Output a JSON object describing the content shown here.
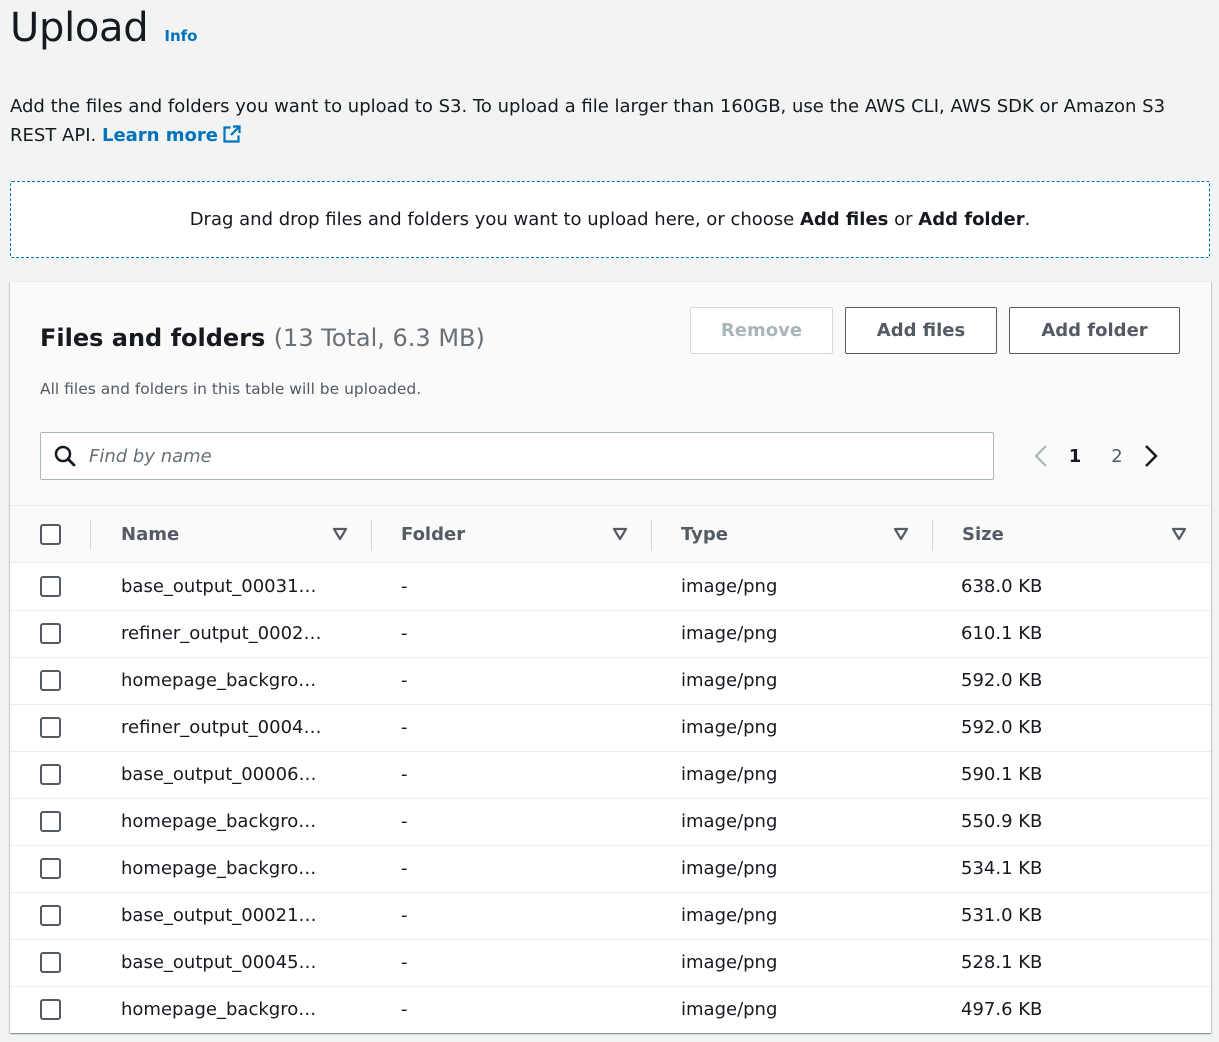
{
  "header": {
    "title": "Upload",
    "info_link": "Info"
  },
  "description": {
    "text": "Add the files and folders you want to upload to S3. To upload a file larger than 160GB, use the AWS CLI, AWS SDK or Amazon S3 REST API.",
    "learn_more": "Learn more"
  },
  "dropzone": {
    "text_before": "Drag and drop files and folders you want to upload here, or choose",
    "add_files": "Add files",
    "or": "or",
    "add_folder": "Add folder",
    "period": "."
  },
  "panel": {
    "title": "Files and folders",
    "count": "(13 Total, 6.3 MB)",
    "description": "All files and folders in this table will be uploaded.",
    "buttons": {
      "remove": "Remove",
      "add_files": "Add files",
      "add_folder": "Add folder"
    },
    "search": {
      "placeholder": "Find by name",
      "value": ""
    },
    "pagination": {
      "pages": [
        "1",
        "2"
      ],
      "current": "1"
    }
  },
  "table": {
    "columns": [
      "Name",
      "Folder",
      "Type",
      "Size"
    ],
    "rows": [
      {
        "name": "base_output_00031…",
        "folder": "-",
        "type": "image/png",
        "size": "638.0 KB"
      },
      {
        "name": "refiner_output_0002…",
        "folder": "-",
        "type": "image/png",
        "size": "610.1 KB"
      },
      {
        "name": "homepage_backgro…",
        "folder": "-",
        "type": "image/png",
        "size": "592.0 KB"
      },
      {
        "name": "refiner_output_0004…",
        "folder": "-",
        "type": "image/png",
        "size": "592.0 KB"
      },
      {
        "name": "base_output_00006…",
        "folder": "-",
        "type": "image/png",
        "size": "590.1 KB"
      },
      {
        "name": "homepage_backgro…",
        "folder": "-",
        "type": "image/png",
        "size": "550.9 KB"
      },
      {
        "name": "homepage_backgro…",
        "folder": "-",
        "type": "image/png",
        "size": "534.1 KB"
      },
      {
        "name": "base_output_00021…",
        "folder": "-",
        "type": "image/png",
        "size": "531.0 KB"
      },
      {
        "name": "base_output_00045…",
        "folder": "-",
        "type": "image/png",
        "size": "528.1 KB"
      },
      {
        "name": "homepage_backgro…",
        "folder": "-",
        "type": "image/png",
        "size": "497.6 KB"
      }
    ]
  },
  "icons": {
    "search": "search-icon",
    "external": "external-link-icon",
    "sort": "caret-down-icon",
    "prev": "chevron-left-icon",
    "next": "chevron-right-icon"
  },
  "colors": {
    "link": "#0073bb",
    "background": "#f2f3f3",
    "text": "#16191f",
    "muted": "#545b64",
    "disabled": "#aab7b8"
  }
}
